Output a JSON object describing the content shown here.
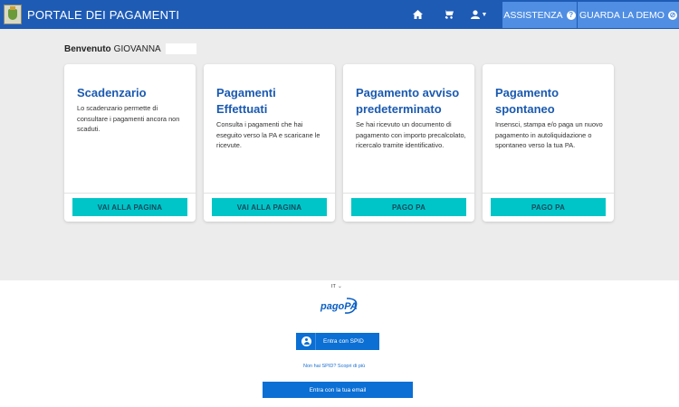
{
  "header": {
    "title": "PORTALE DEI PAGAMENTI",
    "nav_icons": [
      "home-icon",
      "cart-icon",
      "user-icon"
    ],
    "assist_label": "ASSISTENZA",
    "demo_label": "GUARDA LA DEMO",
    "assist_icon_glyph": "?",
    "demo_icon_glyph": "⊘"
  },
  "welcome": {
    "prefix": "Benvenuto",
    "name": "GIOVANNA"
  },
  "cards": [
    {
      "title": "Scadenzario",
      "description": "Lo scadenzario permette di consultare i pagamenti ancora non scaduti.",
      "button": "VAI ALLA PAGINA"
    },
    {
      "title": "Pagamenti Effettuati",
      "description": "Consulta i pagamenti che hai eseguito verso la PA e scaricane le ricevute.",
      "button": "VAI ALLA PAGINA"
    },
    {
      "title": "Pagamento avviso predeterminato",
      "description": "Se hai ricevuto un documento di pagamento con importo precalcolato, ricercalo tramite identificativo.",
      "button": "PAGO PA"
    },
    {
      "title": "Pagamento spontaneo",
      "description": "Insensci, stampa e/o paga un nuovo pagamento in autoliquidazione o spontaneo verso la tua PA.",
      "button": "PAGO PA"
    }
  ],
  "login": {
    "language": "IT",
    "logo_text": "pagoPA",
    "spid_button": "Entra con SPID",
    "no_spid_link": "Non hai SPID? Scopri di più",
    "email_button": "Entra con la tua email"
  },
  "colors": {
    "header_bg": "#1e5bb5",
    "header_button_bg": "#4f8ee3",
    "card_title": "#1a5ab0",
    "card_button": "#00c5c8",
    "main_bg": "#ececec",
    "login_button": "#0b6fd4"
  }
}
